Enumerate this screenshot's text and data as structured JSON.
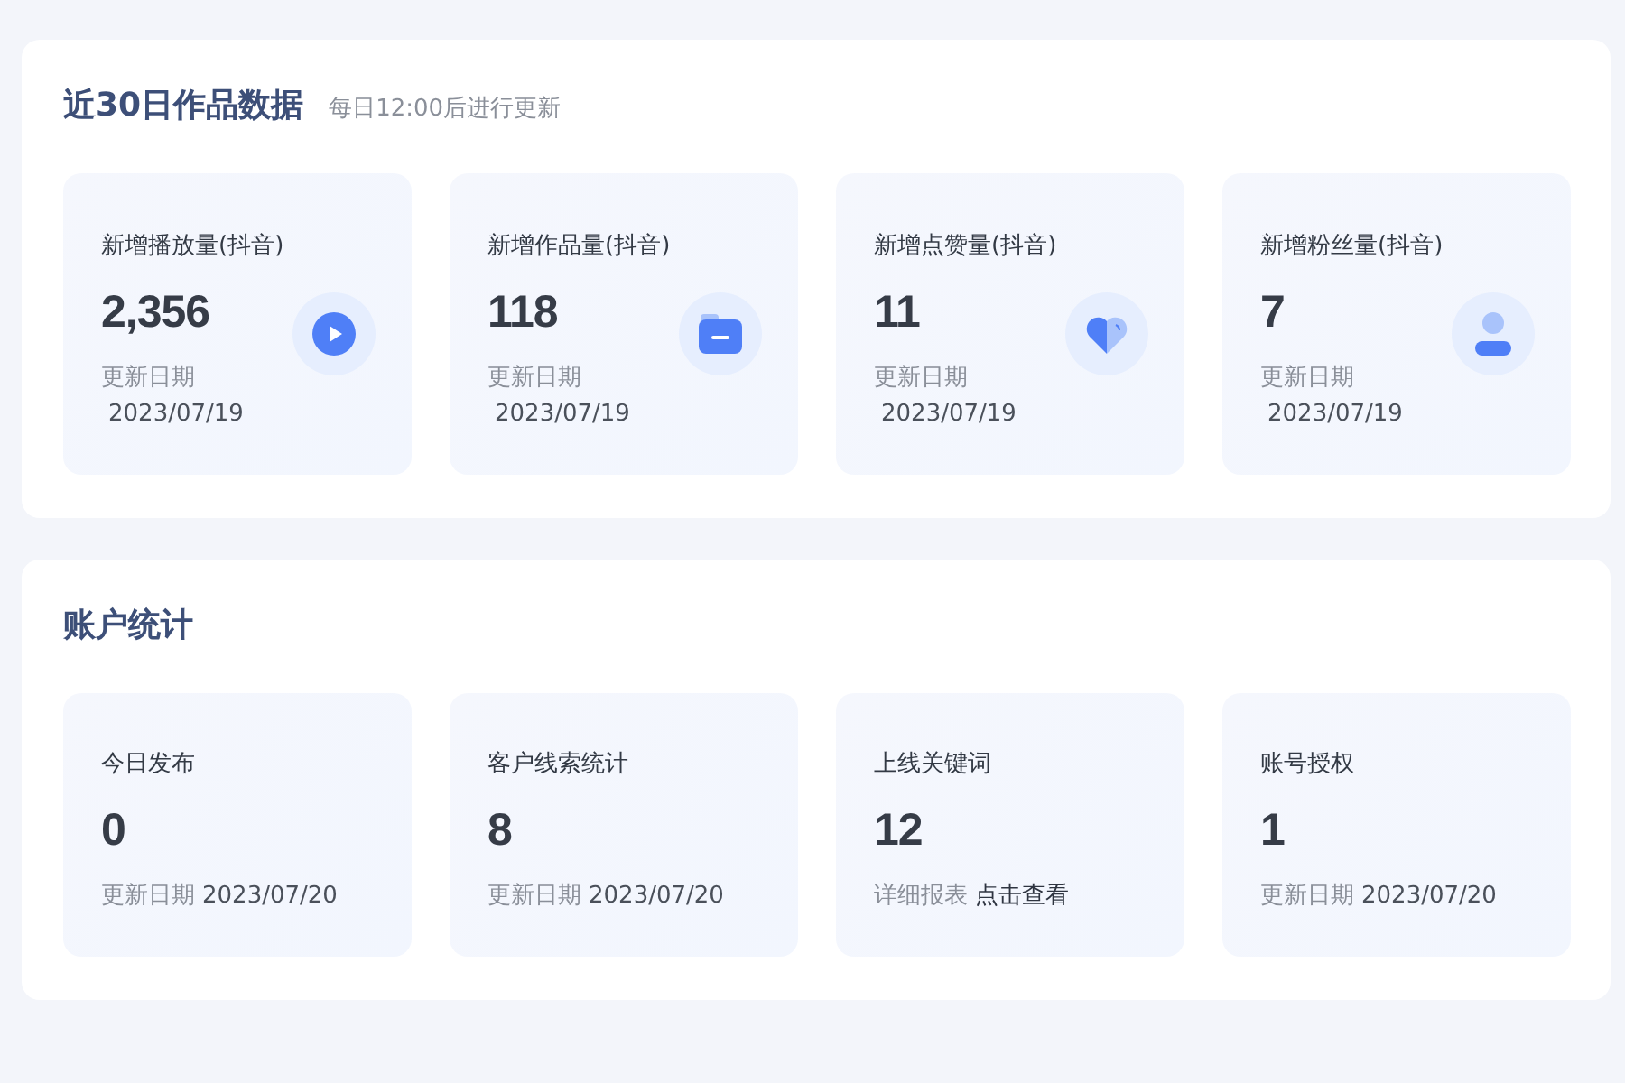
{
  "sections": [
    {
      "title": "近30日作品数据",
      "subtitle": "每日12:00后进行更新",
      "kind": "stacked",
      "cards": [
        {
          "label": "新增播放量(抖音)",
          "value": "2,356",
          "kind": "play",
          "footer": {
            "label": "更新日期",
            "value": "2023/07/19",
            "kind": "date"
          }
        },
        {
          "label": "新增作品量(抖音)",
          "value": "118",
          "kind": "folder",
          "footer": {
            "label": "更新日期",
            "value": "2023/07/19",
            "kind": "date"
          }
        },
        {
          "label": "新增点赞量(抖音)",
          "value": "11",
          "kind": "heart",
          "footer": {
            "label": "更新日期",
            "value": "2023/07/19",
            "kind": "date"
          }
        },
        {
          "label": "新增粉丝量(抖音)",
          "value": "7",
          "kind": "user",
          "footer": {
            "label": "更新日期",
            "value": "2023/07/19",
            "kind": "date"
          }
        }
      ]
    },
    {
      "title": "账户统计",
      "kind": "inline",
      "cards": [
        {
          "label": "今日发布",
          "value": "0",
          "footer": {
            "label": "更新日期",
            "value": "2023/07/20",
            "kind": "date"
          }
        },
        {
          "label": "客户线索统计",
          "value": "8",
          "footer": {
            "label": "更新日期",
            "value": "2023/07/20",
            "kind": "date"
          }
        },
        {
          "label": "上线关键词",
          "value": "12",
          "footer": {
            "label": "详细报表",
            "value": "点击查看",
            "kind": "link"
          }
        },
        {
          "label": "账号授权",
          "value": "1",
          "footer": {
            "label": "更新日期",
            "value": "2023/07/20",
            "kind": "date"
          }
        }
      ]
    }
  ]
}
